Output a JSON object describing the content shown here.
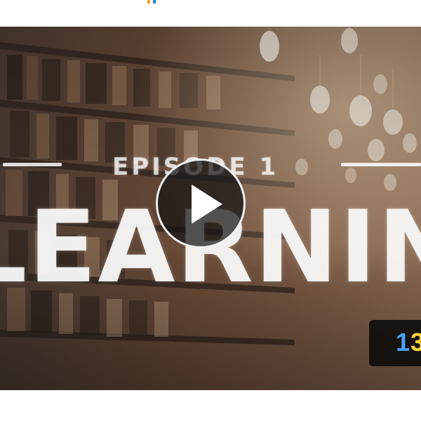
{
  "thumbnail": {
    "episode_label": "EPISODE 1",
    "title": "LEARNING",
    "duration": "13"
  },
  "icons": {
    "play": "play-icon"
  },
  "colors": {
    "accent_orange": "#f5a623",
    "accent_blue": "#1e88c7",
    "overlay_dark": "#141414",
    "text_white": "#f8f8f8"
  }
}
